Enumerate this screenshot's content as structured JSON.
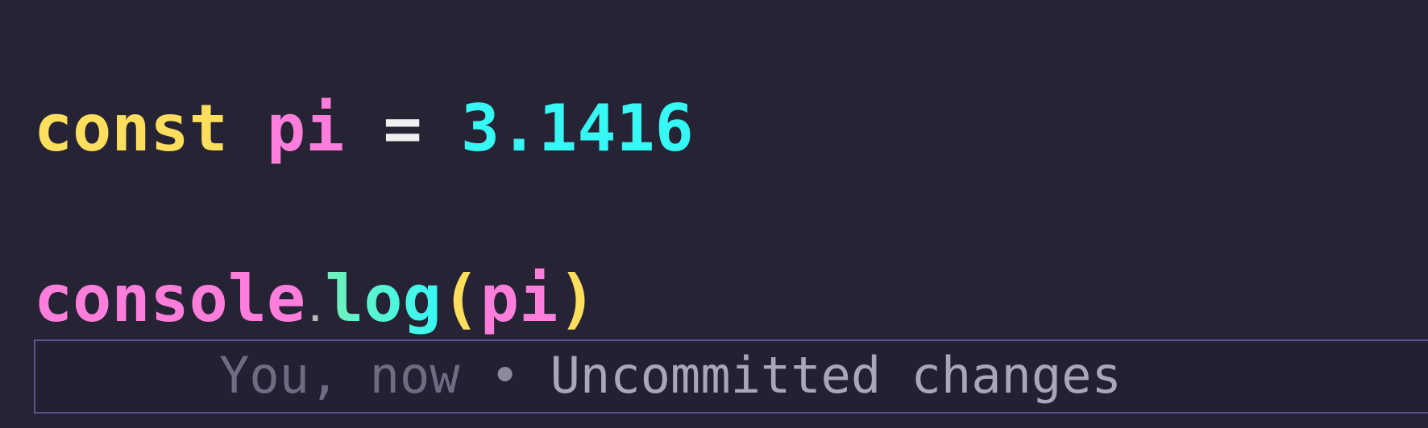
{
  "editor": {
    "lines": [
      {
        "keyword": "const",
        "identifier": "pi",
        "operator": "=",
        "value": "3.1416"
      },
      {
        "object": "console",
        "dot": ".",
        "method": "log",
        "open_paren": "(",
        "argument": "pi",
        "close_paren": ")"
      }
    ],
    "blame": {
      "author": "You,",
      "time": "now",
      "separator": "•",
      "message": "Uncommitted changes"
    }
  },
  "colors": {
    "background": "#262335",
    "keyword": "#fede5d",
    "identifier": "#ff7edb",
    "number": "#36f9f6",
    "method": "#72f1b8",
    "paren": "#fede5d",
    "line_highlight_border": "#5a5490"
  }
}
